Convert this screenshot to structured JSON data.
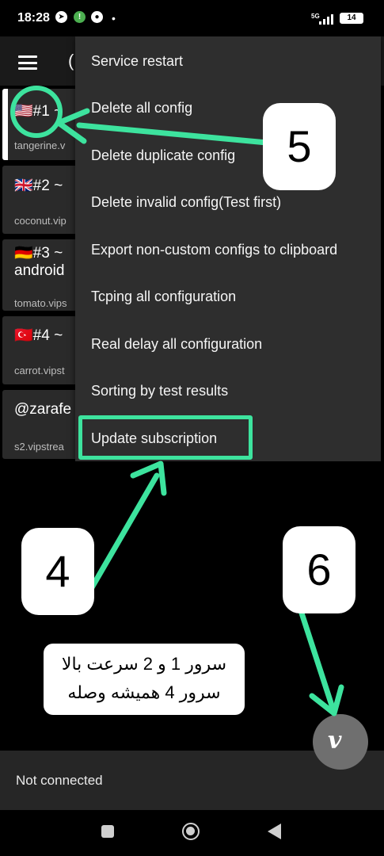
{
  "status_bar": {
    "time": "18:28",
    "network": "5G",
    "battery": "14"
  },
  "toolbar": {
    "title_fragment": "("
  },
  "server_list": [
    {
      "title": "🇺🇸#1 ~",
      "subtitle": "tangerine.v"
    },
    {
      "title": "🇬🇧#2 ~",
      "subtitle": "coconut.vip"
    },
    {
      "title": "🇩🇪#3 ~",
      "title_line2": "android",
      "subtitle": "tomato.vips"
    },
    {
      "title": "🇹🇷#4 ~",
      "subtitle": "carrot.vipst"
    },
    {
      "title": "@zarafe",
      "subtitle": "s2.vipstrea"
    }
  ],
  "menu": {
    "items": [
      "Service restart",
      "Delete all config",
      "Delete duplicate config",
      "Delete invalid config(Test first)",
      "Export non-custom configs to clipboard",
      "Tcping all configuration",
      "Real delay all configuration",
      "Sorting by test results",
      "Update subscription"
    ]
  },
  "annotations": {
    "badge_5": "5",
    "badge_4": "4",
    "badge_6": "6",
    "note_line1": "سرور 1 و 2 سرعت بالا",
    "note_line2": "سرور 4 همیشه وصله",
    "accent_color": "#3de39e"
  },
  "footer": {
    "connection_status": "Not connected",
    "fab_symbol": "v"
  }
}
